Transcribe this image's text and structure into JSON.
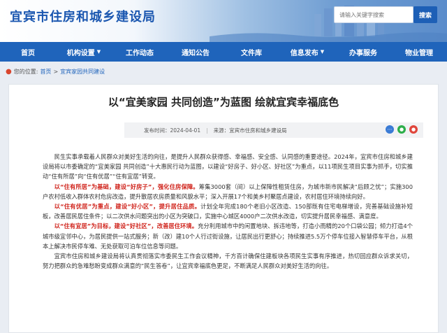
{
  "header": {
    "site_title": "宜宾市住房和城乡建设局",
    "search_placeholder": "请输入关键字搜索",
    "search_button": "搜索"
  },
  "nav": {
    "items": [
      {
        "label": "首页",
        "dropdown": false
      },
      {
        "label": "机构设置",
        "dropdown": true
      },
      {
        "label": "工作动态",
        "dropdown": false
      },
      {
        "label": "通知公告",
        "dropdown": false
      },
      {
        "label": "文件库",
        "dropdown": false
      },
      {
        "label": "信息发布",
        "dropdown": true
      },
      {
        "label": "办事服务",
        "dropdown": false
      },
      {
        "label": "物业管理",
        "dropdown": false
      }
    ]
  },
  "breadcrumb": {
    "prefix": "您的位置:",
    "home": "首页",
    "sep": ">",
    "current": "宜宾家园共同建设"
  },
  "article": {
    "title": "以“宜美家园 共同创造”为蓝图 绘就宜宾幸福底色",
    "date_label": "发布时间：2024-04-01",
    "source_label": "来源：宜宾市住房和城乡建设局",
    "p1": "民生实事承载着人民群众对美好生活的向往，是提升人民群众获得感、幸福感、安全感、认同感的重要途径。2024年，宜宾市住房和城乡建设局将以市委确定的“宜美家园 共同创造”十大惠民行动为蓝图，以建设“好房子、好小区、好社区”为重点，以11项民生项目实事为抓手，切实推动“住有所居”向“住有优居”“住有宜居”转变。",
    "p2_red": "以“住有所居”为基础，建设“好房子”，强化住房保障。",
    "p2_rest": "筹集3000套（间）以上保障性租赁住房，为城市新市民解决“后顾之忧”；实施300户农村低收入群体农村危房改造，提升散居农房质量和风貌水平；深入开展17个和美乡村聚居点建设，农村居住环境持续向好。",
    "p3_red": "以“住有优居”为重点，建设“好小区”，提升居住品质。",
    "p3_rest": "计划全年完成180个老旧小区改造、150部既有住宅电梯增设，完善基础设施补短板，改善居民居住条件；以二次供水问题突出的小区为突破口，实施中心城区4000户二次供水改造，切实提升居民幸福感、满意度。",
    "p4_red": "以“住有宜居”为目标，建设“好社区”，改善居住环境。",
    "p4_rest": "充分利用城市中的闲置地块、拆违地等，打造小而精的20个口袋公园；倾力打造4个城市级宜邻中心，为居民提供一站式服务；新（改）建10个人行过街设施，让居民出行更舒心；持续推进5.5万个停车位接入智慧停车平台，从根本上解决市民停车难、无处获取可泊车位信息等问题。",
    "p5": "宜宾市住房和城乡建设局将认真贯彻落实市委民生工作会议精神，千方百计确保住建板块各项民生实事有序推进，热切回应群众诉求关切，努力把群众的急难愁盼变成群众满意的“民生答卷”，让宜宾幸福底色更足，不断满足人民群众对美好生活的向往。"
  },
  "colors": {
    "brand_blue": "#1f64bb",
    "highlight_red": "#d0241c"
  }
}
